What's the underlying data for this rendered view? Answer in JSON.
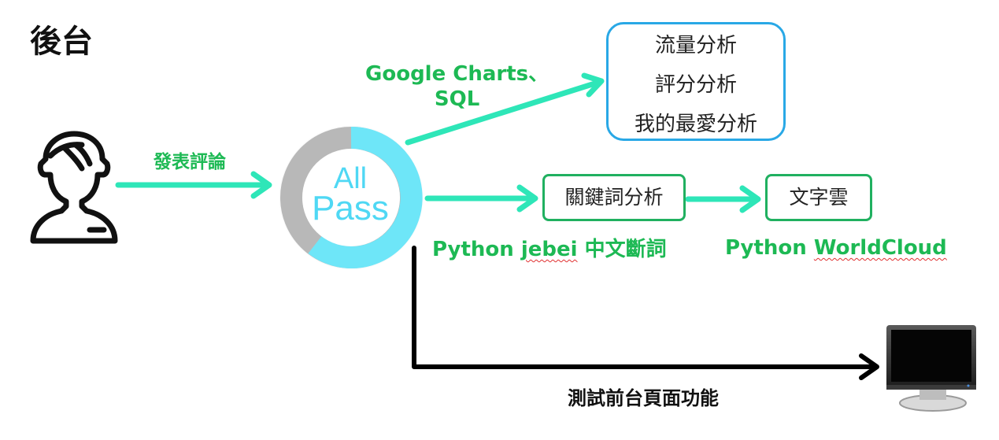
{
  "page": {
    "title": "後台"
  },
  "nodes": {
    "logo": {
      "line1": "All",
      "line2": "Pass"
    },
    "analysis_box": {
      "items": [
        "流量分析",
        "評分分析",
        "我的最愛分析"
      ]
    },
    "keyword_box": {
      "label": "關鍵詞分析"
    },
    "wordcloud_box": {
      "label": "文字雲"
    }
  },
  "edges": {
    "publish": {
      "label": "發表評論"
    },
    "charts": {
      "line1": "Google Charts、",
      "line2": "SQL"
    },
    "jebei": {
      "prefix": "Python ",
      "word": "jebei",
      "suffix": " 中文斷詞"
    },
    "wordcloud": {
      "prefix": "Python ",
      "word": "WorldCloud"
    },
    "frontend_test": {
      "label": "測試前台頁面功能"
    }
  },
  "colors": {
    "arrow_cyan": "#2ee6b8",
    "arrow_black": "#000000",
    "label_green": "#1db954",
    "blue_border": "#29a8e6",
    "green_border": "#20b060",
    "ring_cyan": "#6ee6f8",
    "ring_gray": "#b8b8b8"
  },
  "icons": {
    "user": "user-silhouette-icon",
    "monitor": "computer-monitor-icon"
  }
}
